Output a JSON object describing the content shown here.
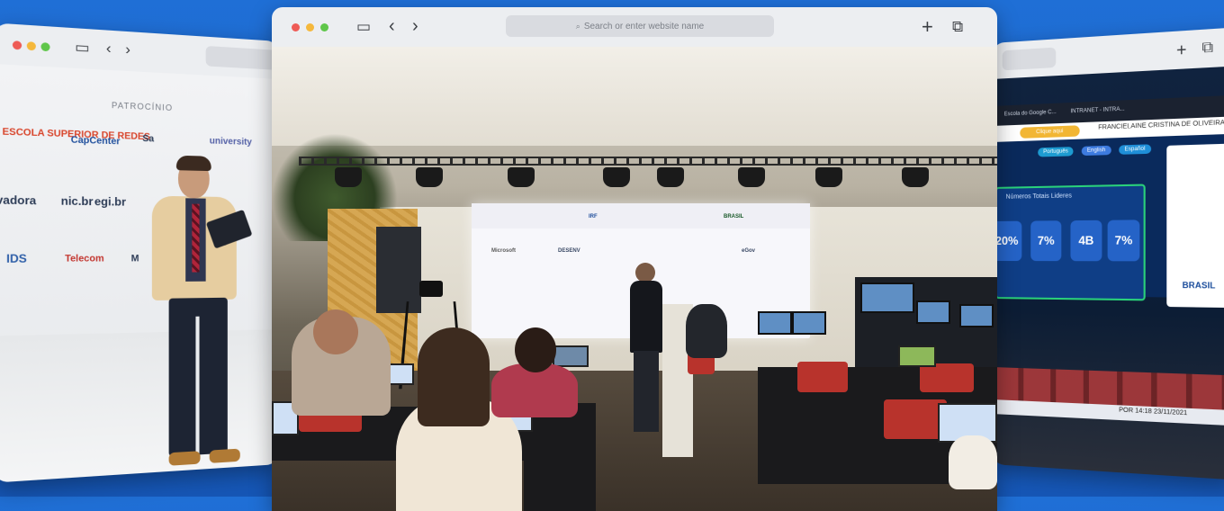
{
  "windows": {
    "center": {
      "url_placeholder": "Search or enter website name",
      "screen": {
        "title": "",
        "logos": [
          "Microsoft",
          "DESENV",
          "eGov",
          "IRF",
          "BRASIL"
        ]
      }
    },
    "left": {
      "sponsor_heading": "PATROCÍNIO",
      "logos": [
        "ESCOLA SUPERIOR DE REDES",
        "CapCenter",
        "Sa",
        "university",
        "vadora",
        "nic.br",
        "egi.br",
        "IDS",
        "Telecom",
        "M"
      ]
    },
    "right": {
      "tabs": [
        "Escola do Google C...",
        "INTRANET - INTRA..."
      ],
      "user_name": "FRANCIELAINE CRISTINA DE OLIVEIRA",
      "cta_label": "Clique aqui",
      "languages": [
        {
          "label": "Português",
          "color": "#1d9bd1"
        },
        {
          "label": "English",
          "color": "#3d7be0"
        },
        {
          "label": "Español",
          "color": "#1f8fd8"
        }
      ],
      "panel_title": "Números Totais Lideres",
      "tiles": [
        "20%",
        "7%",
        "4B",
        "7%"
      ],
      "brand": "BRASIL",
      "tray_lang": "POR",
      "tray_time": "14:18",
      "tray_date": "23/11/2021"
    }
  },
  "icons": [
    "sidebar-icon",
    "back-icon",
    "forward-icon",
    "new-tab-icon",
    "tabs-overview-icon",
    "search-icon"
  ],
  "colors": {
    "background": "#1f6fd6",
    "toolbar": "#eceef1",
    "traffic_red": "#ee5b56",
    "traffic_yellow": "#f5b83c",
    "traffic_green": "#5fc64a"
  }
}
